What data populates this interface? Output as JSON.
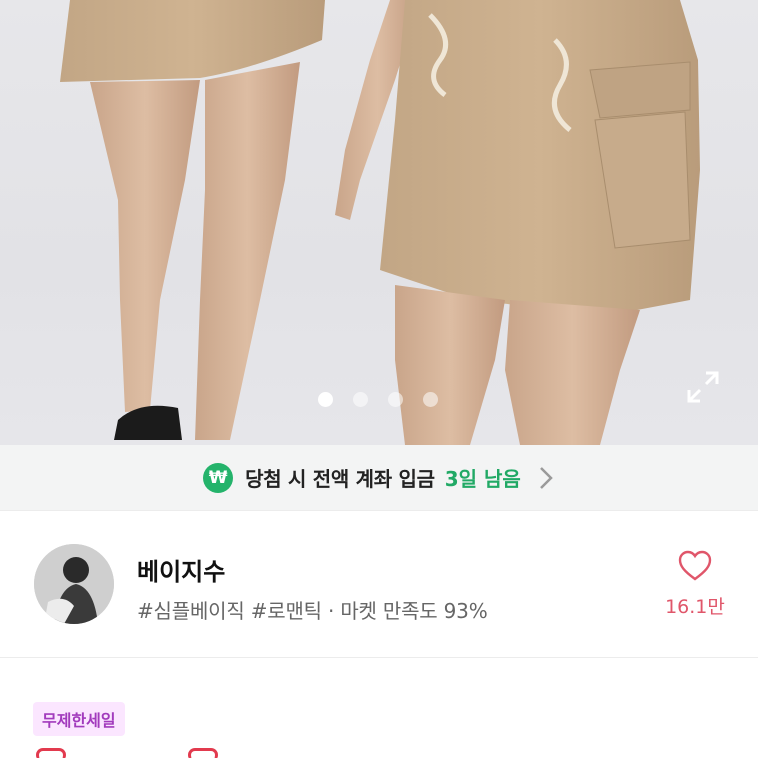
{
  "hero": {
    "image_alt": "beige cargo mini skirt product photo",
    "carousel": {
      "count": 4,
      "active_index": 0
    },
    "expand_icon": "expand-icon"
  },
  "banner": {
    "icon": "won-icon",
    "icon_glyph": "₩",
    "text": "당첨 시 전액 계좌 입금",
    "days": "3일 남음"
  },
  "shop": {
    "name": "베이지수",
    "tags": "#심플베이직 #로맨틱 · 마켓 만족도 93%",
    "likes": "16.1만",
    "accent": "#e0566a"
  },
  "sale_badge": "무제한세일"
}
